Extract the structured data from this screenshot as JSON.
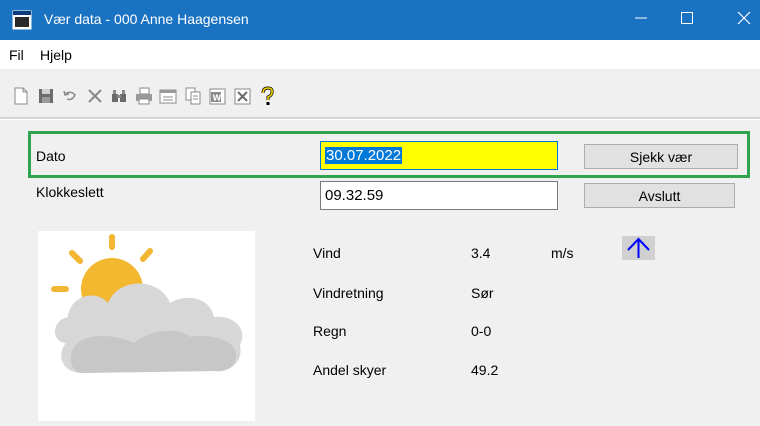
{
  "window": {
    "title": "Vær data - 000 Anne Haagensen"
  },
  "menu": {
    "items": [
      "Fil",
      "Hjelp"
    ]
  },
  "toolbar": {
    "icons": [
      "new-document-icon",
      "save-icon",
      "undo-icon",
      "delete-icon",
      "find-icon",
      "print-icon",
      "form-icon",
      "copy-icon",
      "word-export-icon",
      "close-box-icon",
      "help-icon"
    ]
  },
  "form": {
    "date_label": "Dato",
    "date_value": "30.07.2022",
    "time_label": "Klokkeslett",
    "time_value": "09.32.59",
    "check_button": "Sjekk vær",
    "exit_button": "Avslutt"
  },
  "weather": {
    "wind_label": "Vind",
    "wind_value": "3.4",
    "wind_unit": "m/s",
    "direction_label": "Vindretning",
    "direction_value": "Sør",
    "rain_label": "Regn",
    "rain_value": "0-0",
    "cloud_label": "Andel skyer",
    "cloud_value": "49.2",
    "icon": "partly-cloudy-icon",
    "wind_arrow_icon": "arrow-up-icon"
  },
  "colors": {
    "titlebar": "#1a73c2",
    "date_field_bg": "#ffff00",
    "selection": "#0078d7",
    "highlight_frame": "#2ea44f",
    "wind_arrow": "#0000ff"
  }
}
